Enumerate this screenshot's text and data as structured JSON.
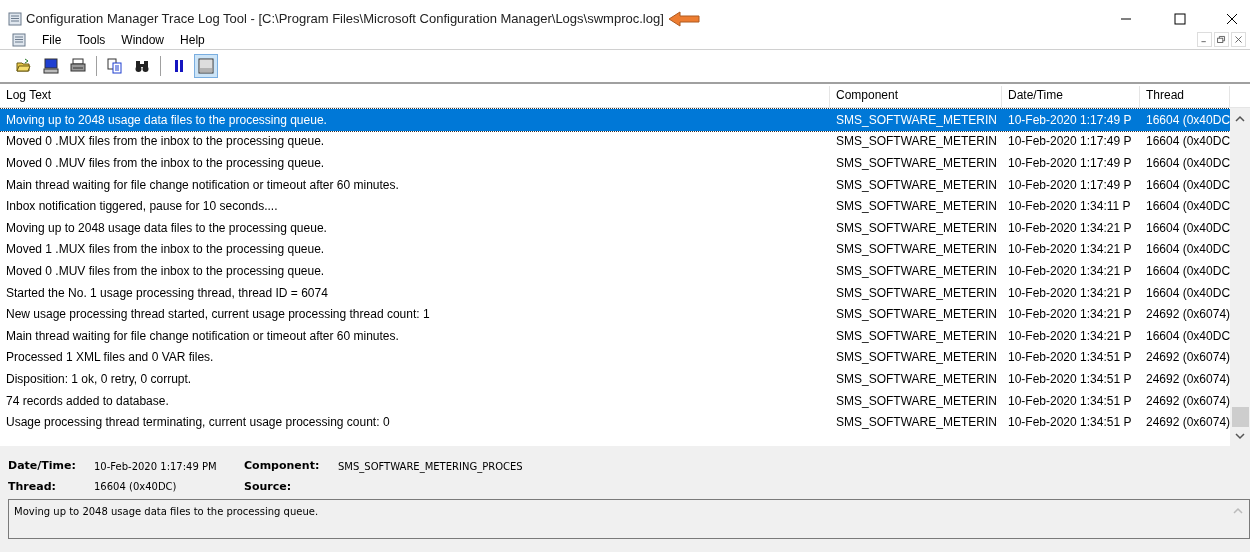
{
  "window": {
    "title": "Configuration Manager Trace Log Tool - [C:\\Program Files\\Microsoft Configuration Manager\\Logs\\swmproc.log]"
  },
  "menu": [
    "File",
    "Tools",
    "Window",
    "Help"
  ],
  "toolbar": [
    {
      "kind": "open",
      "pressed": false
    },
    {
      "kind": "computer",
      "pressed": false
    },
    {
      "kind": "print",
      "pressed": false
    },
    {
      "kind": "sep"
    },
    {
      "kind": "copy",
      "pressed": false
    },
    {
      "kind": "find",
      "pressed": false
    },
    {
      "kind": "sep"
    },
    {
      "kind": "pause",
      "pressed": false
    },
    {
      "kind": "pane",
      "pressed": true
    }
  ],
  "table": {
    "columns": [
      "Log Text",
      "Component",
      "Date/Time",
      "Thread"
    ],
    "rows": [
      {
        "text": "Moving up to 2048 usage data files to the processing queue.",
        "component": "SMS_SOFTWARE_METERIN",
        "datetime": "10-Feb-2020 1:17:49 P",
        "thread": "16604 (0x40DC",
        "selected": true
      },
      {
        "text": "Moved 0 .MUX files from the inbox to the processing queue.",
        "component": "SMS_SOFTWARE_METERIN",
        "datetime": "10-Feb-2020 1:17:49 P",
        "thread": "16604 (0x40DC",
        "selected": false
      },
      {
        "text": "Moved 0 .MUV files from the inbox to the processing queue.",
        "component": "SMS_SOFTWARE_METERIN",
        "datetime": "10-Feb-2020 1:17:49 P",
        "thread": "16604 (0x40DC",
        "selected": false
      },
      {
        "text": "Main thread waiting for file change notification or timeout after 60 minutes.",
        "component": "SMS_SOFTWARE_METERIN",
        "datetime": "10-Feb-2020 1:17:49 P",
        "thread": "16604 (0x40DC",
        "selected": false
      },
      {
        "text": "Inbox notification tiggered, pause for 10 seconds....",
        "component": "SMS_SOFTWARE_METERIN",
        "datetime": "10-Feb-2020 1:34:11 P",
        "thread": "16604 (0x40DC",
        "selected": false
      },
      {
        "text": "Moving up to 2048 usage data files to the processing queue.",
        "component": "SMS_SOFTWARE_METERIN",
        "datetime": "10-Feb-2020 1:34:21 P",
        "thread": "16604 (0x40DC",
        "selected": false
      },
      {
        "text": "Moved 1 .MUX files from the inbox to the processing queue.",
        "component": "SMS_SOFTWARE_METERIN",
        "datetime": "10-Feb-2020 1:34:21 P",
        "thread": "16604 (0x40DC",
        "selected": false
      },
      {
        "text": "Moved 0 .MUV files from the inbox to the processing queue.",
        "component": "SMS_SOFTWARE_METERIN",
        "datetime": "10-Feb-2020 1:34:21 P",
        "thread": "16604 (0x40DC",
        "selected": false
      },
      {
        "text": "Started the No. 1 usage processing thread, thread ID = 6074",
        "component": "SMS_SOFTWARE_METERIN",
        "datetime": "10-Feb-2020 1:34:21 P",
        "thread": "16604 (0x40DC",
        "selected": false
      },
      {
        "text": "New usage processing thread started, current usage processing thread count: 1",
        "component": "SMS_SOFTWARE_METERIN",
        "datetime": "10-Feb-2020 1:34:21 P",
        "thread": "24692 (0x6074)",
        "selected": false
      },
      {
        "text": "Main thread waiting for file change notification or timeout after 60 minutes.",
        "component": "SMS_SOFTWARE_METERIN",
        "datetime": "10-Feb-2020 1:34:21 P",
        "thread": "16604 (0x40DC",
        "selected": false
      },
      {
        "text": "Processed 1 XML files and 0 VAR files.",
        "component": "SMS_SOFTWARE_METERIN",
        "datetime": "10-Feb-2020 1:34:51 P",
        "thread": "24692 (0x6074)",
        "selected": false
      },
      {
        "text": "Disposition: 1 ok, 0 retry, 0 corrupt.",
        "component": "SMS_SOFTWARE_METERIN",
        "datetime": "10-Feb-2020 1:34:51 P",
        "thread": "24692 (0x6074)",
        "selected": false
      },
      {
        "text": "74 records added to database.",
        "component": "SMS_SOFTWARE_METERIN",
        "datetime": "10-Feb-2020 1:34:51 P",
        "thread": "24692 (0x6074)",
        "selected": false
      },
      {
        "text": "Usage processing thread terminating, current usage processing count: 0",
        "component": "SMS_SOFTWARE_METERIN",
        "datetime": "10-Feb-2020 1:34:51 P",
        "thread": "24692 (0x6074)",
        "selected": false
      }
    ]
  },
  "details": {
    "datetime_label": "Date/Time:",
    "datetime": "10-Feb-2020 1:17:49 PM",
    "component_label": "Component:",
    "component": "SMS_SOFTWARE_METERING_PROCES",
    "thread_label": "Thread:",
    "thread": "16604 (0x40DC)",
    "source_label": "Source:",
    "message": "Moving up to 2048 usage data files to the processing queue."
  }
}
